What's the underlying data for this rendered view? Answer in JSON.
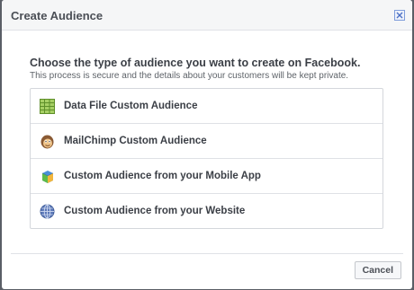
{
  "dialog": {
    "title": "Create Audience",
    "heading": "Choose the type of audience you want to create on Facebook.",
    "subtext": "This process is secure and the details about your customers will be kept private.",
    "options": [
      {
        "label": "Data File Custom Audience",
        "icon": "spreadsheet-icon"
      },
      {
        "label": "MailChimp Custom Audience",
        "icon": "mailchimp-icon"
      },
      {
        "label": "Custom Audience from your Mobile App",
        "icon": "mobile-app-icon"
      },
      {
        "label": "Custom Audience from your Website",
        "icon": "globe-icon"
      }
    ],
    "cancel_label": "Cancel"
  }
}
